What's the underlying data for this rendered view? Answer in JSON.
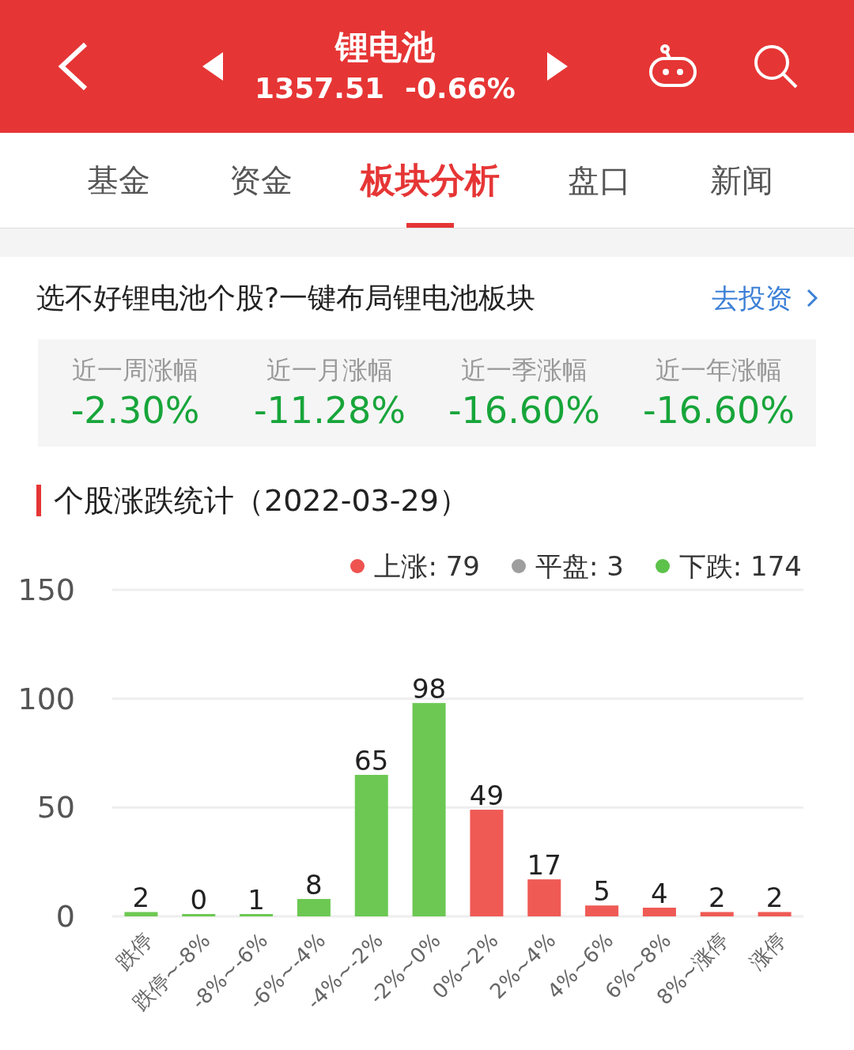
{
  "header": {
    "title": "锂电池",
    "index_value": "1357.51",
    "index_change": "-0.66%"
  },
  "tabs": [
    {
      "label": "基金",
      "selected": false
    },
    {
      "label": "资金",
      "selected": false
    },
    {
      "label": "板块分析",
      "selected": true
    },
    {
      "label": "盘口",
      "selected": false
    },
    {
      "label": "新闻",
      "selected": false
    }
  ],
  "promo": {
    "text": "选不好锂电池个股?一键布局锂电池板块",
    "link": "去投资"
  },
  "returns": [
    {
      "label": "近一周涨幅",
      "value": "-2.30%"
    },
    {
      "label": "近一月涨幅",
      "value": "-11.28%"
    },
    {
      "label": "近一季涨幅",
      "value": "-16.60%"
    },
    {
      "label": "近一年涨幅",
      "value": "-16.60%"
    }
  ],
  "section_title": "个股涨跌统计（2022-03-29）",
  "legend": [
    {
      "label": "上涨: 79",
      "color": "#ef5350"
    },
    {
      "label": "平盘: 3",
      "color": "#9e9e9e"
    },
    {
      "label": "下跌: 174",
      "color": "#5cc24a"
    }
  ],
  "chart_data": {
    "type": "bar",
    "categories": [
      "跌停",
      "跌停~-8%",
      "-8%~-6%",
      "-6%~-4%",
      "-4%~-2%",
      "-2%~0%",
      "0%~2%",
      "2%~4%",
      "4%~6%",
      "6%~8%",
      "8%~涨停",
      "涨停"
    ],
    "series": [
      {
        "color": "#6cc852",
        "values": [
          2,
          0,
          1,
          8,
          65,
          98,
          null,
          null,
          null,
          null,
          null,
          null
        ]
      },
      {
        "color": "#ef5a55",
        "values": [
          null,
          null,
          null,
          null,
          null,
          null,
          49,
          17,
          5,
          4,
          2,
          2
        ]
      }
    ],
    "ylim": [
      0,
      150
    ],
    "yticks": [
      0,
      50,
      100,
      150
    ],
    "data_labels": true
  }
}
